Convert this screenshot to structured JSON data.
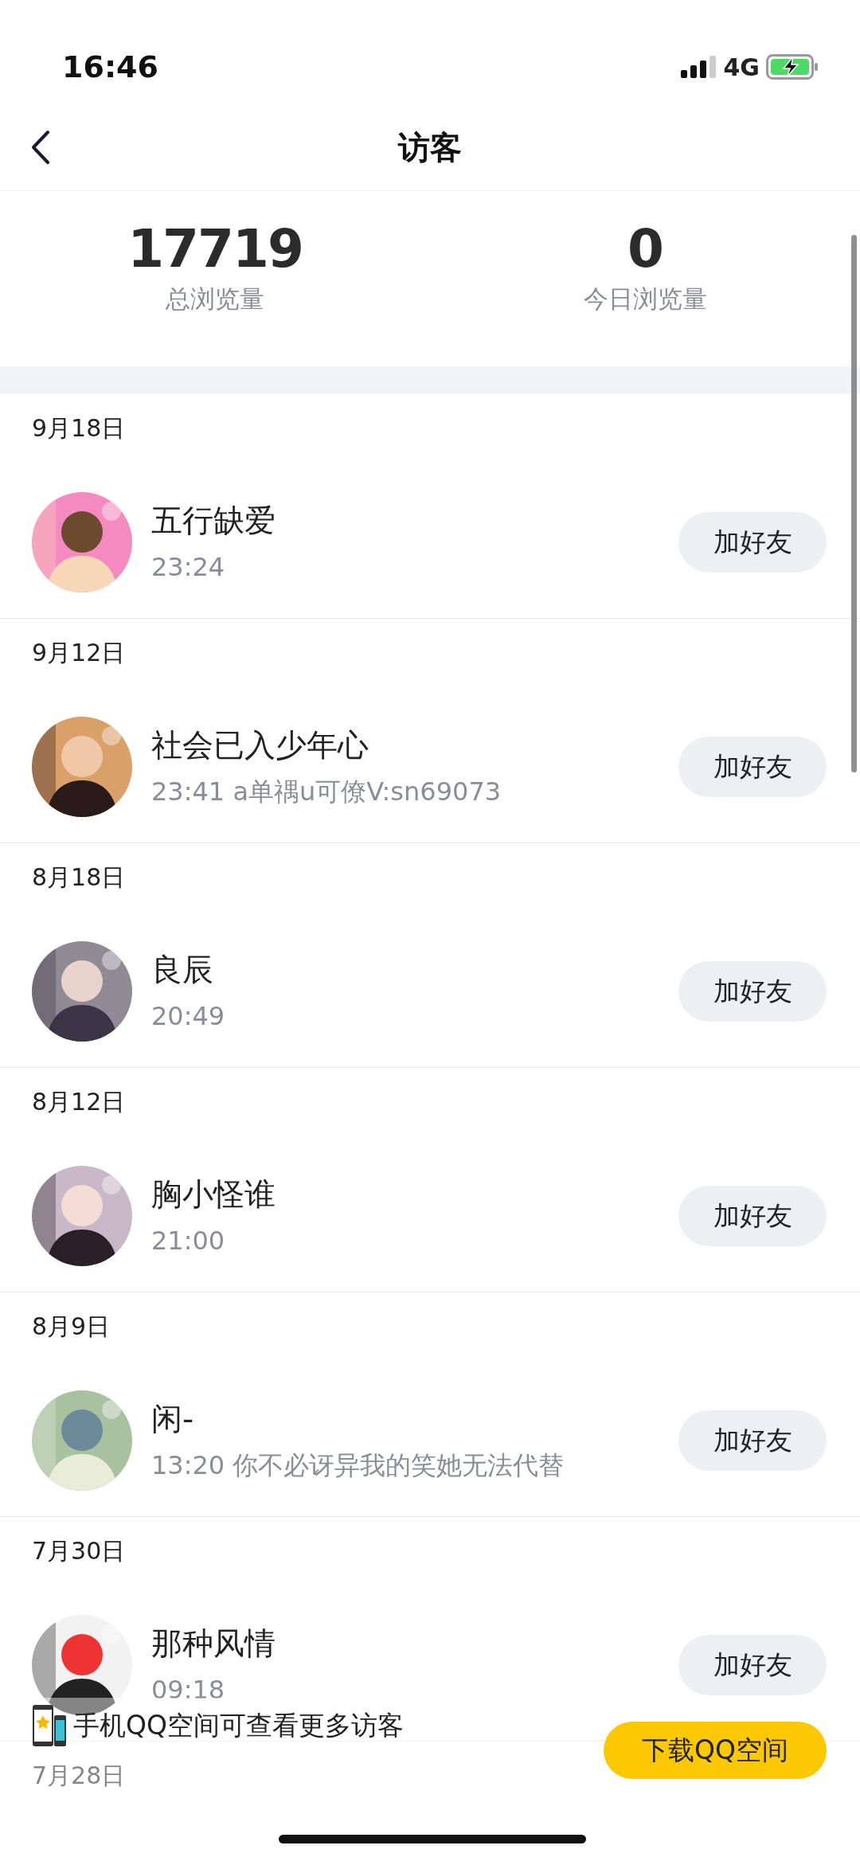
{
  "status_bar": {
    "time": "16:46",
    "network": "4G"
  },
  "header": {
    "title": "访客"
  },
  "stats": [
    {
      "value": "17719",
      "label": "总浏览量"
    },
    {
      "value": "0",
      "label": "今日浏览量"
    }
  ],
  "sections": [
    {
      "date": "9月18日",
      "visitors": [
        {
          "name": "五行缺爱",
          "detail": "23:24",
          "button": "加好友"
        }
      ]
    },
    {
      "date": "9月12日",
      "visitors": [
        {
          "name": "社会已入少年心",
          "detail": "23:41 a单禑u可僚V:sn69073",
          "button": "加好友"
        }
      ]
    },
    {
      "date": "8月18日",
      "visitors": [
        {
          "name": "良辰",
          "detail": "20:49",
          "button": "加好友"
        }
      ]
    },
    {
      "date": "8月12日",
      "visitors": [
        {
          "name": "胸小怪谁",
          "detail": "21:00",
          "button": "加好友"
        }
      ]
    },
    {
      "date": "8月9日",
      "visitors": [
        {
          "name": "闲-",
          "detail": "13:20 你不必讶异我的笑她无法代替",
          "button": "加好友"
        }
      ]
    },
    {
      "date": "7月30日",
      "visitors": [
        {
          "name": "那种风情",
          "detail": "09:18",
          "button": "加好友"
        }
      ]
    },
    {
      "date": "7月28日"
    }
  ],
  "banner": {
    "text": "手机QQ空间可查看更多访客",
    "button": "下载QQ空间"
  }
}
